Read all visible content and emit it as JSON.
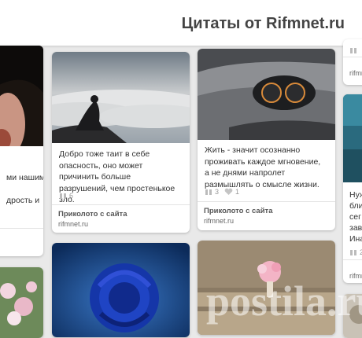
{
  "header": {
    "title": "Цитаты от Rifmnet.ru"
  },
  "left_partial": {
    "desc_line1": "ми нашим",
    "desc_line2": "дрость и"
  },
  "pins": [
    {
      "desc": "Добро тоже таит в себе опасность, оно может причинить больше разрушений, чем простенькое зло.",
      "repins": "6",
      "via_label": "Приколото с сайта",
      "via_site": "rifmnet.ru"
    },
    {
      "desc": "Жить - значит осознанно проживать каждое мгновение, а не днями напролет размышлять о смысле жизни.",
      "repins": "3",
      "likes": "1",
      "via_label": "Приколото с сайта",
      "via_site": "rifmnet.ru"
    }
  ],
  "right_partial": {
    "top_site": "rifmn",
    "desc_line1": "Нуж",
    "desc_line2": "бли",
    "desc_line3": "сег",
    "desc_line4": "зав",
    "desc_line5": "Ина",
    "count": "2",
    "bottom_site": "rifmn"
  },
  "watermark": "postila.ru",
  "colors": {
    "accent_rose": "#1a3fbf",
    "header_bg": "#ffffff",
    "page_bg": "#e9e9e9"
  }
}
